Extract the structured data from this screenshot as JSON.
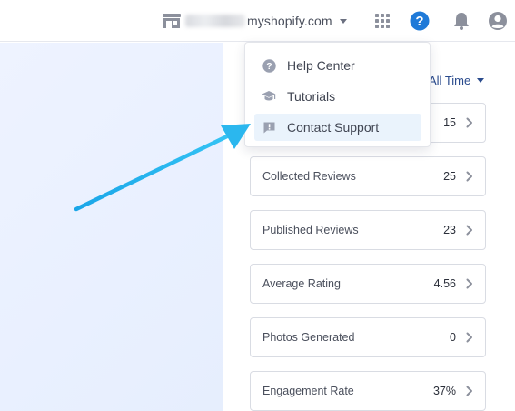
{
  "header": {
    "store_domain": "myshopify.com",
    "icons": [
      "store-icon",
      "apps-grid-icon",
      "help-icon",
      "bell-icon",
      "user-icon"
    ]
  },
  "help_menu": {
    "items": [
      {
        "label": "Help Center",
        "icon": "question-circle-icon"
      },
      {
        "label": "Tutorials",
        "icon": "graduation-cap-icon"
      },
      {
        "label": "Contact Support",
        "icon": "chat-alert-icon",
        "active": true
      }
    ]
  },
  "stats": {
    "range_label": "All Time",
    "cards": [
      {
        "label": "",
        "value": "15"
      },
      {
        "label": "Collected Reviews",
        "value": "25"
      },
      {
        "label": "Published Reviews",
        "value": "23"
      },
      {
        "label": "Average Rating",
        "value": "4.56"
      },
      {
        "label": "Photos Generated",
        "value": "0"
      },
      {
        "label": "Engagement Rate",
        "value": "37%"
      }
    ]
  },
  "colors": {
    "accent": "#1f7ad8",
    "arrow": "#2bb7ee",
    "active_bg": "#eaf3fc",
    "left_panel_bg": "#eef3ff"
  }
}
